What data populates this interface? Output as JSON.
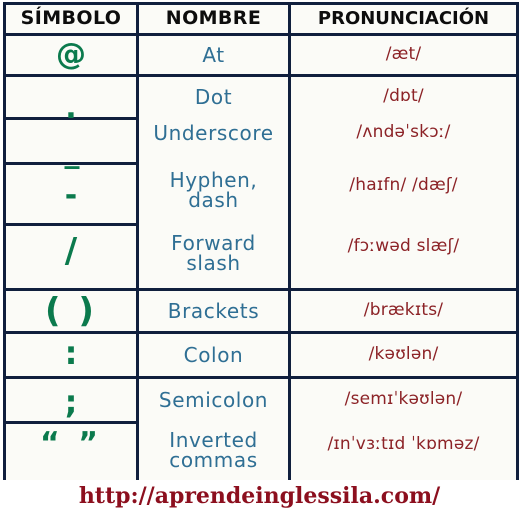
{
  "table": {
    "headers": {
      "symbol": "SÍMBOLO",
      "name": "NOMBRE",
      "pronunciation": "PRONUNCIACIÓN"
    },
    "rows": [
      {
        "symbol": "@",
        "name_line1": "At",
        "name_line2": "",
        "pronunciation": "/æt/"
      },
      {
        "symbol": ".",
        "name_line1": "Dot",
        "name_line2": "",
        "pronunciation": "/dɒt/"
      },
      {
        "symbol": "_",
        "name_line1": "Underscore",
        "name_line2": "",
        "pronunciation": "/ʌndəˈskɔː/"
      },
      {
        "symbol": "-",
        "name_line1": "Hyphen,",
        "name_line2": "dash",
        "pronunciation": "/haɪfn/ /dæʃ/"
      },
      {
        "symbol": "/",
        "name_line1": "Forward",
        "name_line2": "slash",
        "pronunciation": "/fɔːwəd slæʃ/"
      },
      {
        "symbol": "( )",
        "name_line1": "Brackets",
        "name_line2": "",
        "pronunciation": "/brækɪts/"
      },
      {
        "symbol": ":",
        "name_line1": "Colon",
        "name_line2": "",
        "pronunciation": "/kəʊlən/"
      },
      {
        "symbol": ";",
        "name_line1": "Semicolon",
        "name_line2": "",
        "pronunciation": "/semɪˈkəʊlən/"
      },
      {
        "symbol": "“ ”",
        "name_line1": "Inverted",
        "name_line2": "commas",
        "pronunciation": "/ɪnˈvɜːtɪd ˈkɒməz/"
      }
    ]
  },
  "footer": {
    "url": "http://aprendeinglessila.com/"
  },
  "colors": {
    "border": "#101f3d",
    "header_text": "#0d0d0d",
    "symbol_text": "#0b7a4d",
    "name_text": "#2f6f94",
    "pronunciation_text": "#8c2327",
    "footer_text": "#8c0f1e",
    "cell_background": "#fbfbf7",
    "page_background": "#ffffff"
  }
}
